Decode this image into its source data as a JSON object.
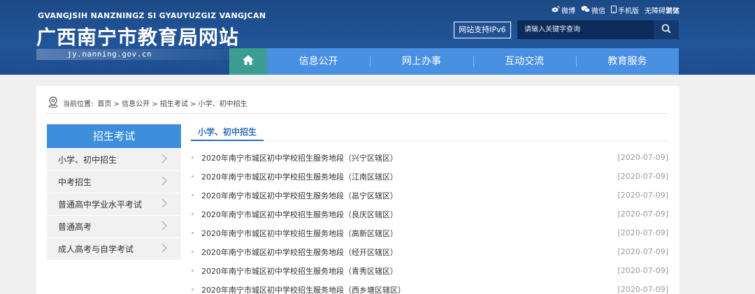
{
  "header": {
    "roman_title": "GVANGJSIH NANZNINGZ SI GYAUYUZGIZ VANGJCAN",
    "title": "广西南宁市教育局网站",
    "domain": "jy.nanning.gov.cn",
    "toplinks": [
      {
        "label": "微博",
        "icon": "weibo-icon"
      },
      {
        "label": "微信",
        "icon": "wechat-icon"
      },
      {
        "label": "手机版",
        "icon": "mobile-icon"
      },
      {
        "label": "无障碍浏览",
        "icon": ""
      }
    ],
    "traditional": "繁体",
    "ipv6": "网站支持IPv6",
    "search_placeholder": "请输入关键字查询"
  },
  "nav": {
    "home_icon": "home-icon",
    "items": [
      "信息公开",
      "网上办事",
      "互动交流",
      "教育服务"
    ]
  },
  "breadcrumb": {
    "label": "当前位置:",
    "path": "首页 > 信息公开 > 招生考试 > 小学、初中招生"
  },
  "sidebar": {
    "title": "招生考试",
    "items": [
      "小学、初中招生",
      "中考招生",
      "普通高中学业水平考试",
      "普通高考",
      "成人高考与自学考试"
    ]
  },
  "content": {
    "tab": "小学、初中招生",
    "news": [
      {
        "title": "2020年南宁市城区初中学校招生服务地段（兴宁区辖区）",
        "date": "[2020-07-09]"
      },
      {
        "title": "2020年南宁市城区初中学校招生服务地段（江南区辖区）",
        "date": "[2020-07-09]"
      },
      {
        "title": "2020年南宁市城区初中学校招生服务地段（邕宁区辖区）",
        "date": "[2020-07-09]"
      },
      {
        "title": "2020年南宁市城区初中学校招生服务地段（良庆区辖区）",
        "date": "[2020-07-09]"
      },
      {
        "title": "2020年南宁市城区初中学校招生服务地段（高新区辖区）",
        "date": "[2020-07-09]"
      },
      {
        "title": "2020年南宁市城区初中学校招生服务地段（经开区辖区）",
        "date": "[2020-07-09]"
      },
      {
        "title": "2020年南宁市城区初中学校招生服务地段（青秀区辖区）",
        "date": "[2020-07-09]"
      },
      {
        "title": "2020年南宁市城区初中学校招生服务地段（西乡塘区辖区）",
        "date": "[2020-07-09]"
      }
    ]
  },
  "colors": {
    "header_bg": "#1f4e8c",
    "nav_blue": "#4a90e2",
    "nav_home": "#3c9e92",
    "accent": "#2f6fb8"
  }
}
